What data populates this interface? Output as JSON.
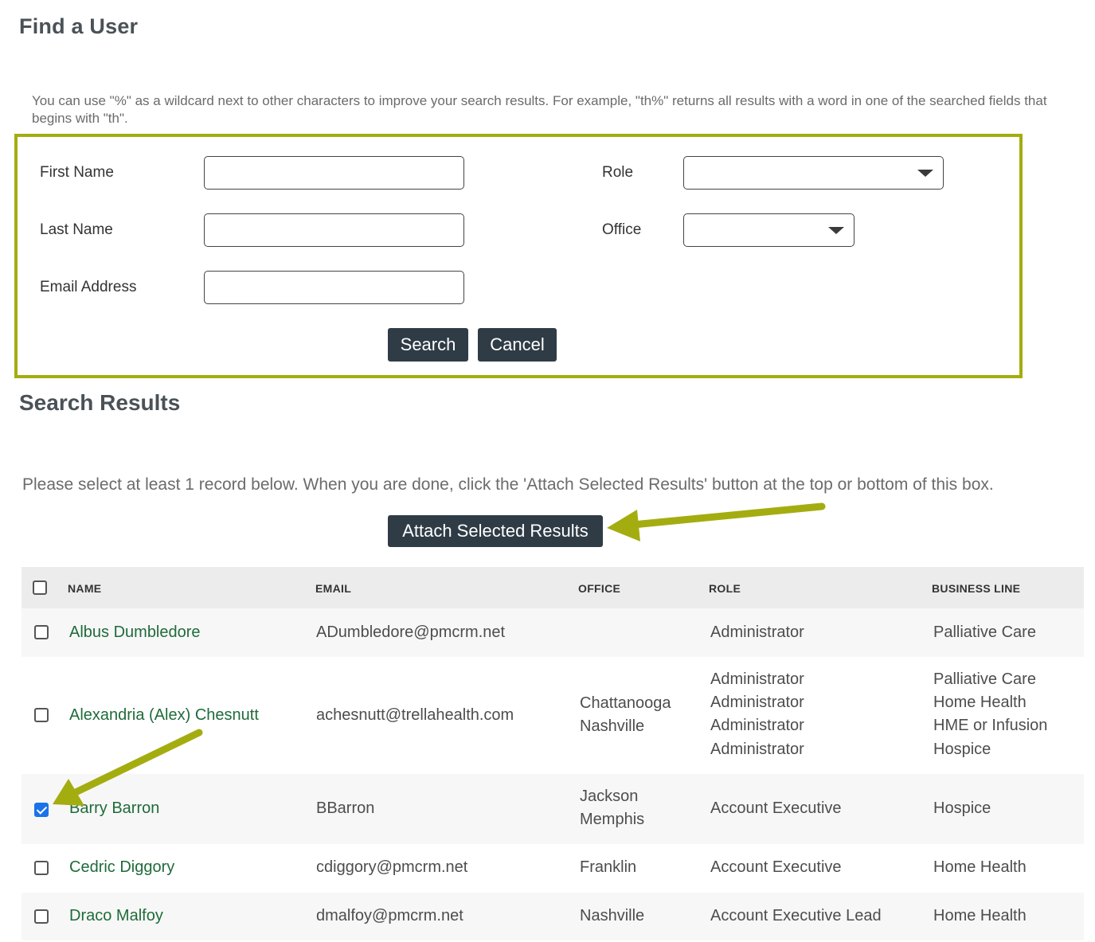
{
  "page": {
    "title": "Find a User",
    "hint": "You can use \"%\" as a wildcard next to other characters to improve your search results. For example, \"th%\" returns all results with a word in one of the searched fields that begins with \"th\"."
  },
  "form": {
    "first_name_label": "First Name",
    "last_name_label": "Last Name",
    "email_label": "Email Address",
    "role_label": "Role",
    "office_label": "Office",
    "first_name_value": "",
    "last_name_value": "",
    "email_value": "",
    "role_value": "",
    "office_value": "",
    "search_label": "Search",
    "cancel_label": "Cancel"
  },
  "results": {
    "title": "Search Results",
    "note": "Please select at least 1 record below. When you are done, click the 'Attach Selected Results' button at the top or bottom of this box.",
    "attach_label": "Attach Selected Results",
    "columns": [
      "NAME",
      "EMAIL",
      "OFFICE",
      "ROLE",
      "BUSINESS LINE"
    ],
    "rows": [
      {
        "checked": false,
        "name": "Albus Dumbledore",
        "email": "ADumbledore@pmcrm.net",
        "office": [],
        "role": [
          "Administrator"
        ],
        "business_line": [
          "Palliative Care"
        ]
      },
      {
        "checked": false,
        "name": "Alexandria (Alex) Chesnutt",
        "email": "achesnutt@trellahealth.com",
        "office": [
          "Chattanooga",
          "Nashville"
        ],
        "role": [
          "Administrator",
          "Administrator",
          "Administrator",
          "Administrator"
        ],
        "business_line": [
          "Palliative Care",
          "Home Health",
          "HME or Infusion",
          "Hospice"
        ]
      },
      {
        "checked": true,
        "name": "Barry Barron",
        "email": "BBarron",
        "office": [
          "Jackson",
          "Memphis"
        ],
        "role": [
          "Account Executive"
        ],
        "business_line": [
          "Hospice"
        ]
      },
      {
        "checked": false,
        "name": "Cedric Diggory",
        "email": "cdiggory@pmcrm.net",
        "office": [
          "Franklin"
        ],
        "role": [
          "Account Executive"
        ],
        "business_line": [
          "Home Health"
        ]
      },
      {
        "checked": false,
        "name": "Draco Malfoy",
        "email": "dmalfoy@pmcrm.net",
        "office": [
          "Nashville"
        ],
        "role": [
          "Account Executive Lead"
        ],
        "business_line": [
          "Home Health"
        ]
      }
    ]
  },
  "colors": {
    "highlight": "#a4ad10",
    "button_bg": "#2f3c46",
    "link_green": "#1f6b3a",
    "checkbox_checked": "#1a73e8"
  }
}
